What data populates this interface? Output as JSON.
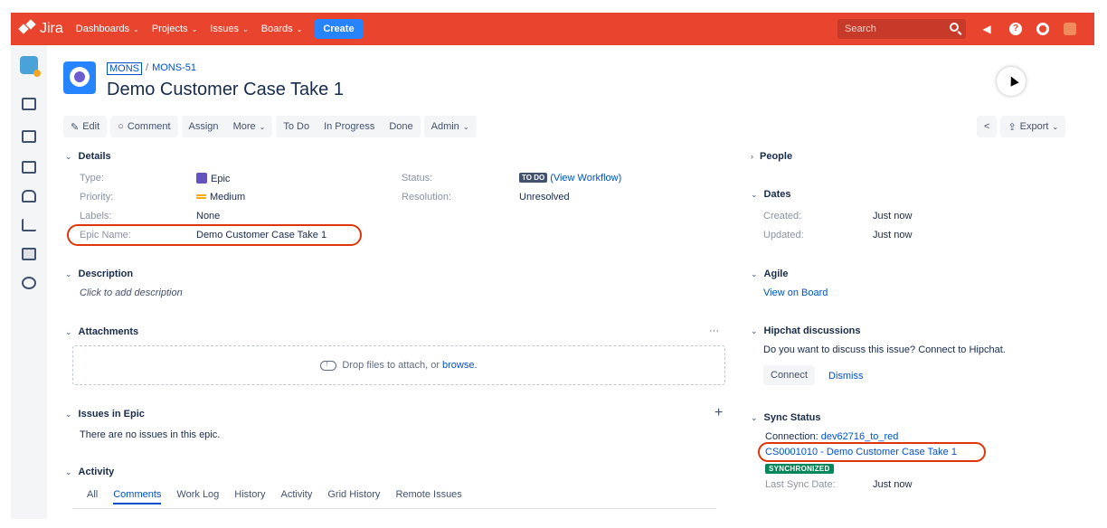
{
  "nav": {
    "logo": "Jira",
    "items": [
      {
        "label": "Dashboards"
      },
      {
        "label": "Projects"
      },
      {
        "label": "Issues"
      },
      {
        "label": "Boards"
      }
    ],
    "create_label": "Create",
    "search_placeholder": "Search"
  },
  "issue": {
    "project_key": "MONS",
    "issue_key": "MONS-51",
    "title": "Demo Customer Case Take 1"
  },
  "toolbar": {
    "edit": "Edit",
    "comment": "Comment",
    "assign": "Assign",
    "more": "More",
    "todo": "To Do",
    "in_progress": "In Progress",
    "done": "Done",
    "admin": "Admin",
    "export": "Export"
  },
  "details": {
    "heading": "Details",
    "type_label": "Type:",
    "type_value": "Epic",
    "priority_label": "Priority:",
    "priority_value": "Medium",
    "labels_label": "Labels:",
    "labels_value": "None",
    "epic_name_label": "Epic Name:",
    "epic_name_value": "Demo Customer Case Take 1",
    "status_label": "Status:",
    "status_value": "TO DO",
    "status_link": "(View Workflow)",
    "resolution_label": "Resolution:",
    "resolution_value": "Unresolved"
  },
  "description": {
    "heading": "Description",
    "placeholder": "Click to add description"
  },
  "attachments": {
    "heading": "Attachments",
    "more": "···",
    "drop_text": "Drop files to attach, or ",
    "browse": "browse."
  },
  "issues_in_epic": {
    "heading": "Issues in Epic",
    "add": "+",
    "empty": "There are no issues in this epic."
  },
  "activity": {
    "heading": "Activity",
    "tabs": [
      "All",
      "Comments",
      "Work Log",
      "History",
      "Activity",
      "Grid History",
      "Remote Issues"
    ],
    "active_tab": "Comments"
  },
  "people": {
    "heading": "People"
  },
  "dates": {
    "heading": "Dates",
    "created_label": "Created:",
    "created_value": "Just now",
    "updated_label": "Updated:",
    "updated_value": "Just now"
  },
  "agile": {
    "heading": "Agile",
    "link": "View on Board"
  },
  "hipchat": {
    "heading": "Hipchat discussions",
    "text": "Do you want to discuss this issue? Connect to Hipchat.",
    "connect": "Connect",
    "dismiss": "Dismiss"
  },
  "sync": {
    "heading": "Sync Status",
    "connection_label": "Connection: ",
    "connection_value": "dev62716_to_red",
    "record": "CS0001010 - Demo Customer Case Take 1",
    "status": "SYNCHRONIZED",
    "last_sync_label": "Last Sync Date:",
    "last_sync_value": "Just now"
  },
  "colors": {
    "nav_bg": "#e8442e",
    "link": "#0052cc",
    "highlight_ring": "#de350b",
    "synchronized": "#00875a"
  }
}
